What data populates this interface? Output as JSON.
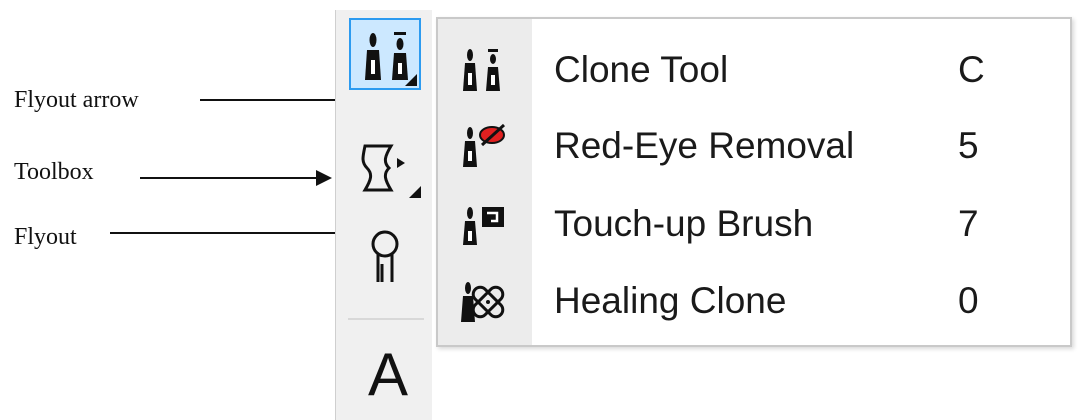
{
  "annotations": {
    "flyout_arrow": "Flyout arrow",
    "toolbox": "Toolbox",
    "flyout": "Flyout"
  },
  "toolbox": {
    "tools": [
      {
        "icon": "clone-tool-icon",
        "active": true,
        "has_flyout": true
      },
      {
        "icon": "shape-tool-icon",
        "active": false,
        "has_flyout": true
      },
      {
        "icon": "tube-tool-icon",
        "active": false,
        "has_flyout": false
      },
      {
        "icon": "text-tool-icon",
        "label": "A",
        "active": false,
        "has_flyout": false
      }
    ]
  },
  "flyout": {
    "items": [
      {
        "icon": "clone-tool-icon",
        "label": "Clone Tool",
        "shortcut": "C"
      },
      {
        "icon": "red-eye-removal-icon",
        "label": "Red-Eye Removal",
        "shortcut": "5"
      },
      {
        "icon": "touch-up-brush-icon",
        "label": "Touch-up Brush",
        "shortcut": "7"
      },
      {
        "icon": "healing-clone-icon",
        "label": "Healing Clone",
        "shortcut": "0"
      }
    ]
  },
  "colors": {
    "active_bg": "#cce8ff",
    "active_border": "#2c9bf0",
    "red_eye": "#e02020"
  }
}
